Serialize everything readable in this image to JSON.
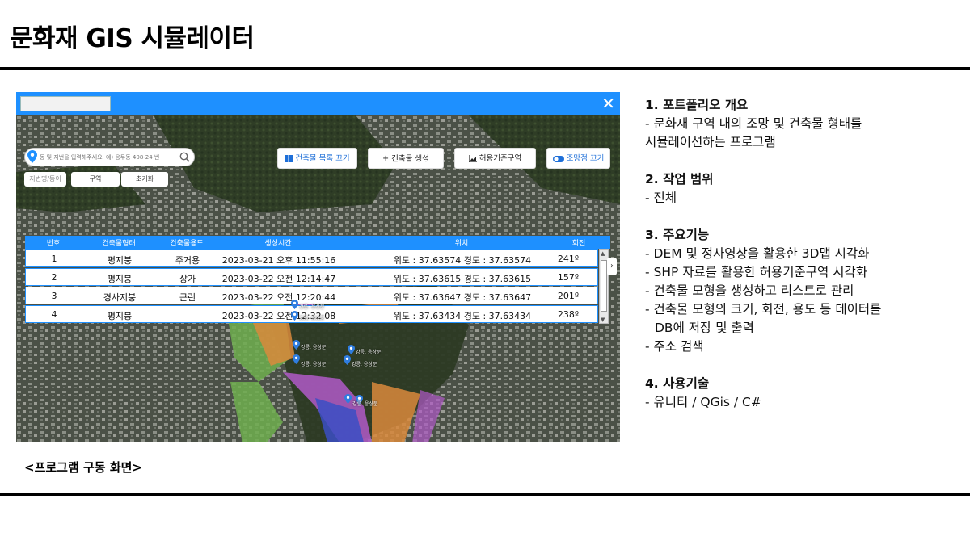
{
  "slide": {
    "title": "문화재 GIS 시뮬레이터",
    "caption": "<프로그램 구동 화면>"
  },
  "app": {
    "close_label": "✕",
    "search": {
      "placeholder": "동 및 지번을 입력해주세요. 예) 응두동 408-24 번"
    },
    "filters": [
      "지번명/동이",
      "구역",
      "초기화"
    ],
    "toolbar": {
      "list_toggle": "건축물 목록 끄기",
      "create": "건축물 생성",
      "allowed_zone": "허용기준구역",
      "viewpoint_toggle": "조망점 끄기"
    },
    "table": {
      "headers": [
        "번호",
        "건축물형태",
        "건축물용도",
        "생성시간",
        "위치",
        "회전"
      ],
      "rows": [
        {
          "no": "1",
          "form": "평지붕",
          "use": "주거용",
          "time": "2023-03-21 오후 11:55:16",
          "pos": "위도 : 37.63574 경도 : 37.63574",
          "rot": "241º"
        },
        {
          "no": "2",
          "form": "평지붕",
          "use": "상가",
          "time": "2023-03-22 오전 12:14:47",
          "pos": "위도 : 37.63615 경도 : 37.63615",
          "rot": "157º"
        },
        {
          "no": "3",
          "form": "경사지붕",
          "use": "근린",
          "time": "2023-03-22 오전 12:20:44",
          "pos": "위도 : 37.63647 경도 : 37.63647",
          "rot": "201º"
        },
        {
          "no": "4",
          "form": "평지붕",
          "use": "",
          "time": "2023-03-22 오전 12:32:08",
          "pos": "위도 : 37.63434 경도 : 37.63434",
          "rot": "238º"
        }
      ]
    },
    "side_handle": "›",
    "map_labels": [
      "강릉. 응상문",
      "강릉. 응상문",
      "강릉. 응상문",
      "강릉. 응상문",
      "강릉. 응상문",
      "강릉. 응상문",
      "강릉. 응상문"
    ]
  },
  "info": {
    "s1_title": "1. 포트폴리오 개요",
    "s1_lines": [
      "- 문화재 구역 내의 조망 및 건축물 형태를",
      "시뮬레이션하는 프로그램"
    ],
    "s2_title": "2. 작업 범위",
    "s2_lines": [
      "- 전체"
    ],
    "s3_title": "3. 주요기능",
    "s3_lines": [
      "- DEM 및 정사영상을 활용한 3D맵 시각화",
      "- SHP 자료를 활용한 허용기준구역 시각화",
      "- 건축물 모형을 생성하고 리스트로 관리",
      "- 건축물 모형의 크기, 회전, 용도 등 데이터를",
      "DB에 저장 및 출력",
      "- 주소 검색"
    ],
    "s4_title": "4. 사용기술",
    "s4_lines": [
      "- 유니티 / QGis / C#"
    ]
  },
  "colors": {
    "titlebar": "#1e90ff",
    "accent": "#1e6fd8",
    "zone_green": "#6fae4f",
    "zone_orange": "#d98a3c",
    "zone_purple": "#b05ac8",
    "zone_blue": "#3b4fc4"
  }
}
